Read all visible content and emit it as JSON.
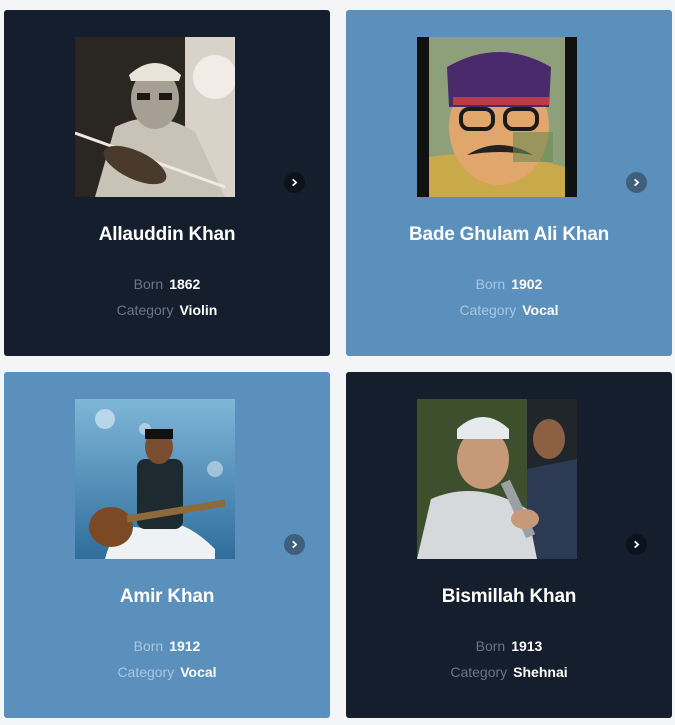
{
  "labels": {
    "born": "Born",
    "category": "Category"
  },
  "cards": [
    {
      "name": "Allauddin Khan",
      "born": "1862",
      "category": "Violin"
    },
    {
      "name": "Bade Ghulam Ali Khan",
      "born": "1902",
      "category": "Vocal"
    },
    {
      "name": "Amir Khan",
      "born": "1912",
      "category": "Vocal"
    },
    {
      "name": "Bismillah Khan",
      "born": "1913",
      "category": "Shehnai"
    }
  ],
  "colors": {
    "dark_card": "#141e2d",
    "blue_card": "#5b90bd"
  },
  "icons": {
    "next": "chevron-right-icon"
  }
}
